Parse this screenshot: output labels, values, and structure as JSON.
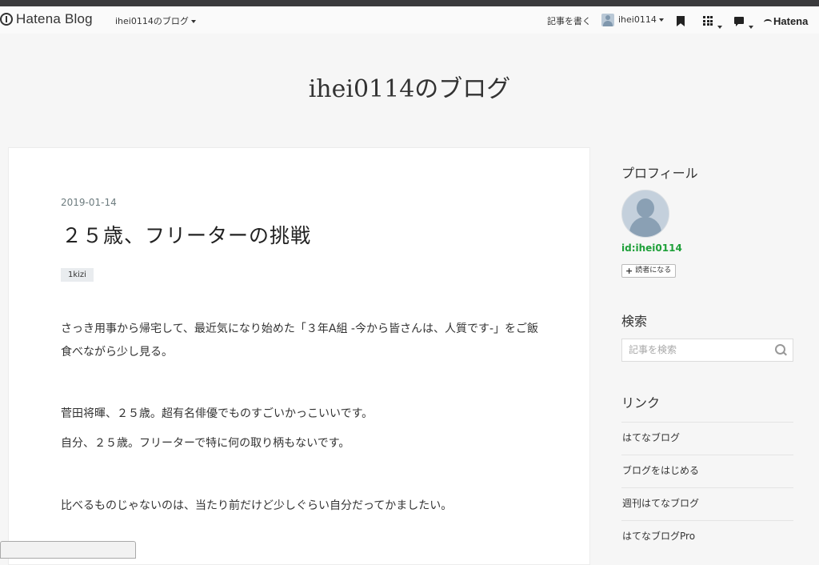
{
  "header": {
    "logo_text": "Hatena Blog",
    "blog_menu": "ihei0114のブログ",
    "write_label": "記事を書く",
    "user_name": "ihei0114",
    "brand": "Hatena",
    "icons": [
      "bookmark-icon",
      "apps-grid-icon",
      "notification-icon"
    ]
  },
  "blog": {
    "title": "ihei0114のブログ"
  },
  "entry": {
    "date": "2019-01-14",
    "title": "２５歳、フリーターの挑戦",
    "category": "1kizi",
    "paragraphs": [
      "さっき用事から帰宅して、最近気になり始めた「３年A組 -今から皆さんは、人質です-」をご飯食べながら少し見る。",
      "菅田将暉、２５歳。超有名俳優でものすごいかっこいいです。",
      "自分、２５歳。フリーターで特に何の取り柄もないです。",
      "比べるものじゃないのは、当たり前だけど少しぐらい自分だってかましたい。"
    ]
  },
  "sidebar": {
    "profile_heading": "プロフィール",
    "profile_id": "id:ihei0114",
    "reader_button": "読者になる",
    "search_heading": "検索",
    "search_placeholder": "記事を検索",
    "links_heading": "リンク",
    "links": [
      "はてなブログ",
      "ブログをはじめる",
      "週刊はてなブログ",
      "はてなブログPro"
    ]
  }
}
